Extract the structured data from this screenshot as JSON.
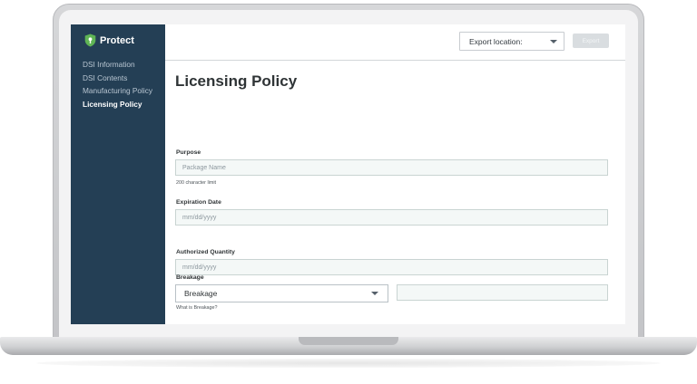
{
  "brand": {
    "name": "Protect",
    "icon": "shield-lock-icon",
    "accent": "#5fb455"
  },
  "sidebar": {
    "background": "#243f55",
    "items": [
      {
        "label": "DSI Information",
        "active": false
      },
      {
        "label": "DSI Contents",
        "active": false
      },
      {
        "label": "Manufacturing Policy",
        "active": false
      },
      {
        "label": "Licensing Policy",
        "active": true
      }
    ]
  },
  "topbar": {
    "export_location": {
      "label": "Export location:",
      "icon": "caret-down-icon"
    },
    "export_button": {
      "label": "Export",
      "enabled": false
    }
  },
  "main": {
    "title": "Licensing Policy",
    "purpose": {
      "label": "Purpose",
      "placeholder": "Package Name",
      "helper": "200 character limit"
    },
    "expiration_date": {
      "label": "Expiration Date",
      "placeholder": "mm/dd/yyyy"
    },
    "authorized_quantity": {
      "label": "Authorized Quantity",
      "placeholder": "mm/dd/yyyy"
    },
    "breakage": {
      "label": "Breakage",
      "selected": "Breakage",
      "helper": "What is Breakage?",
      "value": ""
    }
  }
}
